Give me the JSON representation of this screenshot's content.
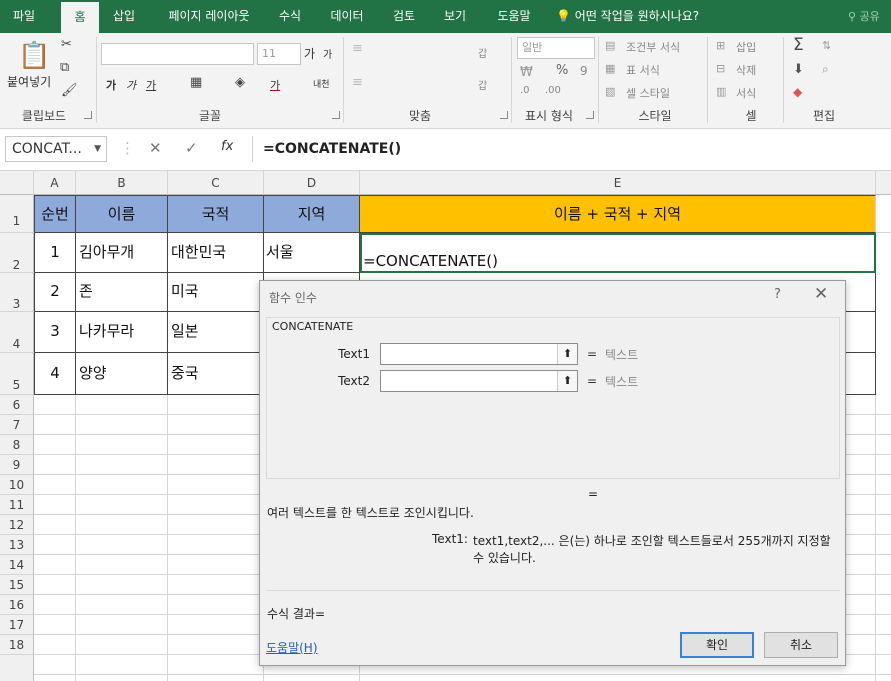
{
  "ribbon_tabs": [
    "파일",
    "홈",
    "삽입",
    "페이지 레이아웃",
    "수식",
    "데이터",
    "검토",
    "보기",
    "도움말"
  ],
  "active_tab": "홈",
  "tell_me": "어떤 작업을 원하시나요?",
  "share": "공유",
  "groups": {
    "clipboard": "클립보드",
    "font": "글꼴",
    "alignment": "맞춤",
    "number": "표시 형식",
    "styles": "스타일",
    "cells": "셀",
    "editing": "편집"
  },
  "clipboard": {
    "paste": "붙여넣기"
  },
  "font": {
    "size": "11",
    "grow": "가",
    "shrink": "가",
    "bold": "가",
    "italic": "가",
    "underline": "가",
    "color_a": "가",
    "phonetic": "내천"
  },
  "alignment": {
    "wrap": "갑",
    "merge": "갑"
  },
  "number": {
    "format": "일반",
    "percent": "%",
    "comma": "9"
  },
  "styles": {
    "conditional": "조건부 서식",
    "table": "표 서식",
    "cell": "셀 스타일"
  },
  "cells": {
    "insert": "삽입",
    "delete": "삭제",
    "format": "서식"
  },
  "formula_bar": {
    "name_box": "CONCAT...",
    "cancel": "✕",
    "enter": "✓",
    "fx": "fx",
    "formula": "=CONCATENATE()"
  },
  "columns": [
    "A",
    "B",
    "C",
    "D",
    "E"
  ],
  "rows": [
    "1",
    "2",
    "3",
    "4",
    "5",
    "6",
    "7",
    "8",
    "9",
    "10",
    "11",
    "12",
    "13",
    "14",
    "15",
    "16",
    "17",
    "18"
  ],
  "table": {
    "headers": [
      "순번",
      "이름",
      "국적",
      "지역",
      "이름 + 국적 + 지역"
    ],
    "rows": [
      [
        "1",
        "김아무개",
        "대한민국",
        "서울",
        "=CONCATENATE()"
      ],
      [
        "2",
        "존",
        "미국",
        "",
        ""
      ],
      [
        "3",
        "나카무라",
        "일본",
        "",
        ""
      ],
      [
        "4",
        "양양",
        "중국",
        "",
        ""
      ]
    ]
  },
  "dialog": {
    "title": "함수 인수",
    "help_q": "?",
    "close": "✕",
    "function_name": "CONCATENATE",
    "args": [
      {
        "label": "Text1",
        "eq": "=",
        "hint": "텍스트"
      },
      {
        "label": "Text2",
        "eq": "=",
        "hint": "텍스트"
      }
    ],
    "result_eq": "=",
    "description": "여러 텍스트를 한 텍스트로 조인시킵니다.",
    "arg_name": "Text1:",
    "arg_desc_1": "text1,text2,... 은(는) 하나로 조인할 텍스트들로서 255개까지 지정할",
    "arg_desc_2": "수 있습니다.",
    "result_label": "수식 결과=",
    "help_link": "도움말(H)",
    "ok": "확인",
    "cancel": "취소"
  },
  "colors": {
    "excel_green": "#217346",
    "header_blue": "#8eaadb",
    "header_gold": "#ffc000"
  }
}
